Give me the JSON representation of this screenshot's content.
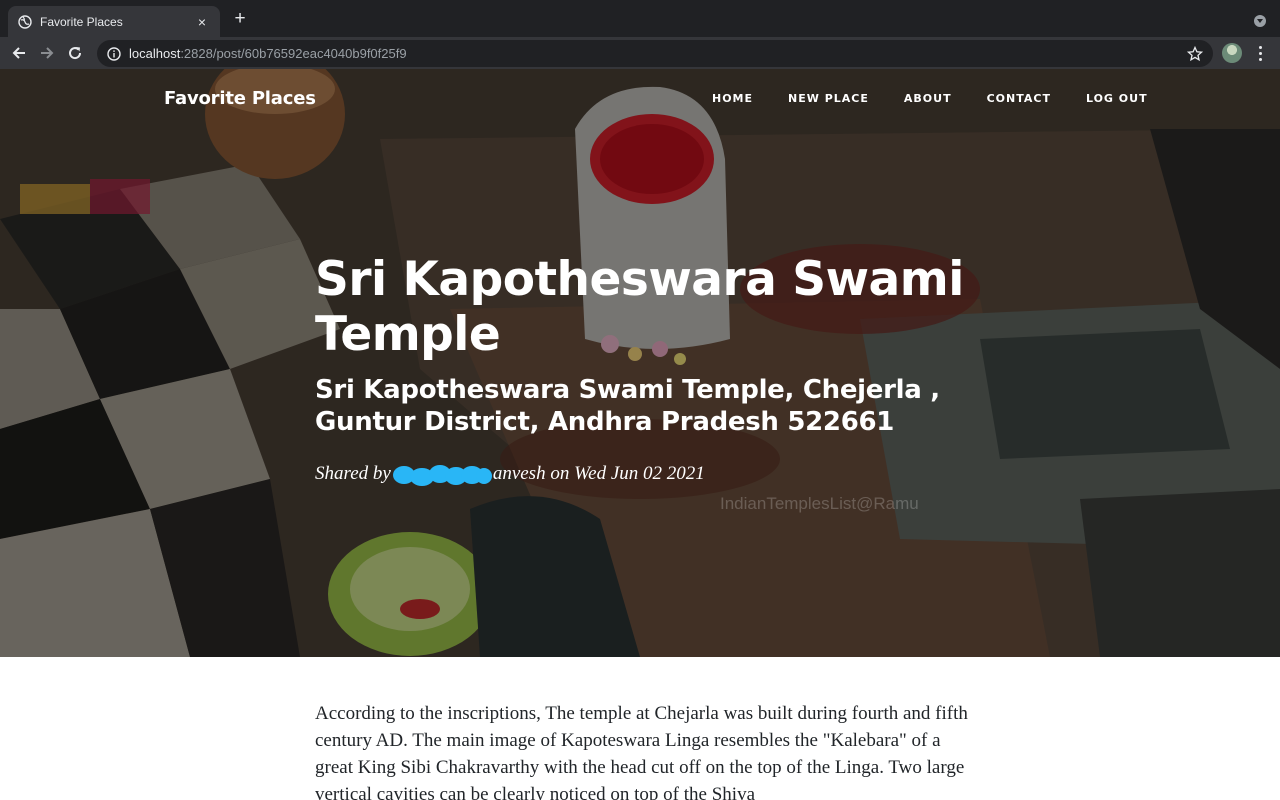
{
  "browser": {
    "tab_title": "Favorite Places",
    "tab_close": "×",
    "new_tab": "+",
    "url_host": "localhost",
    "url_path": ":2828/post/60b76592eac4040b9f0f25f9"
  },
  "site": {
    "brand": "Favorite Places",
    "nav": [
      "HOME",
      "NEW PLACE",
      "ABOUT",
      "CONTACT",
      "LOG OUT"
    ]
  },
  "post": {
    "title": "Sri Kapotheswara Swami Temple",
    "subtitle": "Sri Kapotheswara Swami Temple, Chejerla , Guntur District, Andhra Pradesh 522661",
    "meta_prefix": "Shared by",
    "meta_suffix": "anvesh on Wed Jun 02 2021",
    "watermark": "IndianTemplesList@Ramu",
    "body": "According to the inscriptions, The temple at Chejarla was built during fourth and fifth century AD. The main image of Kapoteswara Linga resembles the \"Kalebara\" of a great King Sibi Chakravarthy with the head cut off on the top of the Linga. Two large vertical cavities can be clearly noticed on top of the Shiva"
  },
  "colors": {
    "tabbar": "#202124",
    "toolbar": "#35363a",
    "redaction": "#29b6f6"
  }
}
